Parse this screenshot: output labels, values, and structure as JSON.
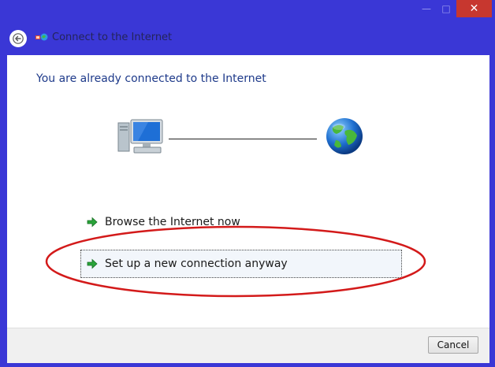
{
  "window": {
    "title": "Connect to the Internet",
    "caption_buttons": {
      "minimize": "—",
      "maximize": "□",
      "close": "✕"
    }
  },
  "page": {
    "heading": "You are already connected to the Internet"
  },
  "options": [
    {
      "label": "Browse the Internet now",
      "icon": "green-arrow-icon"
    },
    {
      "label": "Set up a new connection anyway",
      "icon": "green-arrow-icon",
      "highlighted": true
    }
  ],
  "footer": {
    "cancel_label": "Cancel"
  },
  "colors": {
    "window_frame": "#3a37d6",
    "heading": "#1e3a8a",
    "annotation": "#d31a1a",
    "close_button": "#c7372f"
  }
}
